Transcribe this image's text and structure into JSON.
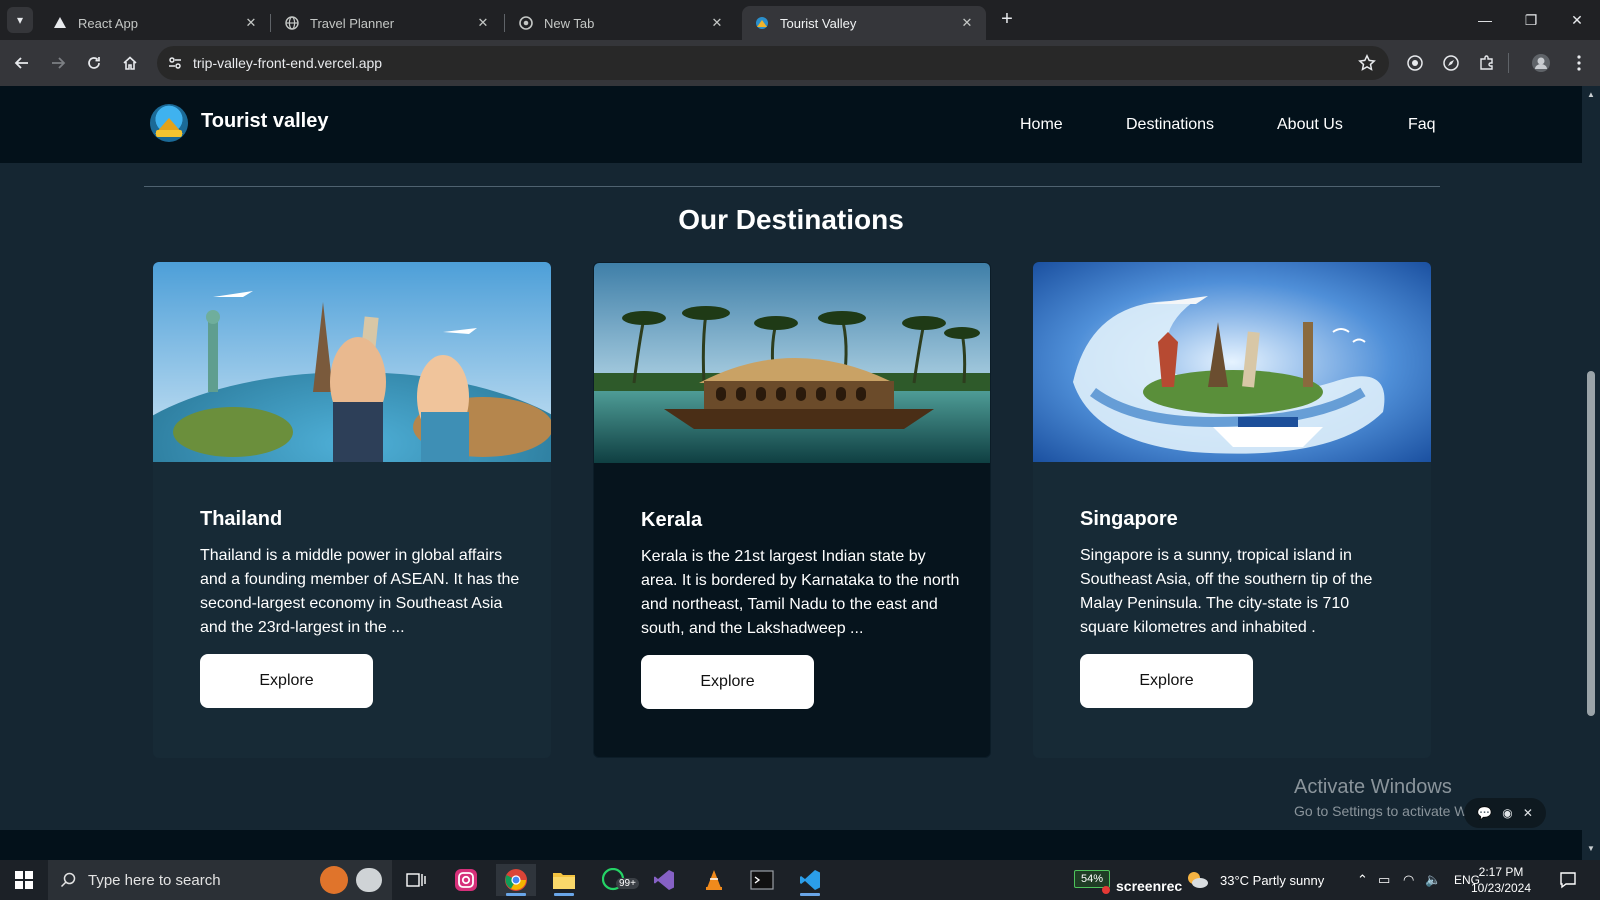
{
  "browser": {
    "tabs": [
      {
        "title": "React App",
        "icon": "react-icon",
        "active": false
      },
      {
        "title": "Travel Planner",
        "icon": "globe-icon",
        "active": false
      },
      {
        "title": "New Tab",
        "icon": "chrome-icon",
        "active": false
      },
      {
        "title": "Tourist Valley",
        "icon": "tourist-valley-favicon",
        "active": true
      }
    ],
    "url": "trip-valley-front-end.vercel.app"
  },
  "site": {
    "brand": "Tourist valley",
    "nav": [
      "Home",
      "Destinations",
      "About Us",
      "Faq"
    ],
    "section_title": "Our Destinations",
    "destinations": [
      {
        "name": "Thailand",
        "description": "Thailand is a middle power in global affairs and a founding member of ASEAN. It has the second-largest economy in Southeast Asia and the 23rd-largest in the ...",
        "button": "Explore",
        "image": "travel-collage-landmarks-photo"
      },
      {
        "name": "Kerala",
        "description": "Kerala is the 21st largest Indian state by area. It is bordered by Karnataka to the north and northeast, Tamil Nadu to the east and south, and the Lakshadweep ...",
        "button": "Explore",
        "image": "houseboat-backwaters-photo"
      },
      {
        "name": "Singapore",
        "description": "Singapore is a sunny, tropical island in Southeast Asia, off the southern tip of the Malay Peninsula. The city-state is 710 square kilometres and inhabited .",
        "button": "Explore",
        "image": "landmarks-wave-cruise-photo"
      }
    ]
  },
  "watermark": {
    "line1": "Activate Windows",
    "line2": "Go to Settings to activate Windows."
  },
  "taskbar": {
    "search_placeholder": "Type here to search",
    "whatsapp_badge": "99+",
    "battery": "54%",
    "screenrec": "screenrec",
    "weather": "33°C  Partly sunny",
    "language": "ENG",
    "time": "2:17 PM",
    "date": "10/23/2024"
  },
  "colors": {
    "page_bg": "#152632",
    "navbar_bg": "#03111a",
    "card_bg": "#172a36",
    "card_alt_bg": "#06141d",
    "button_bg": "#ffffff"
  }
}
